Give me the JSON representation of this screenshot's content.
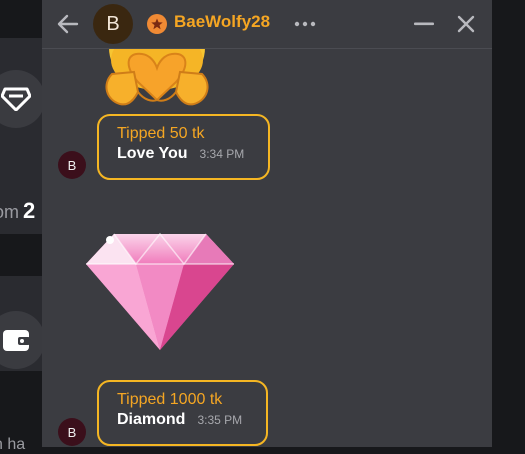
{
  "background_page": {
    "partial_text": "om",
    "partial_number": "2",
    "partial_bottom": "n ha"
  },
  "chat": {
    "username": "BaeWolfy28",
    "avatar_letter": "B",
    "messages": [
      {
        "avatar_letter": "B",
        "tip": "Tipped 50 tk",
        "text": "Love You",
        "time": "3:34 PM",
        "image": "heart-hands-emoji"
      },
      {
        "avatar_letter": "B",
        "tip": "Tipped 1000 tk",
        "text": "Diamond",
        "time": "3:35 PM",
        "image": "pink-diamond"
      }
    ]
  },
  "colors": {
    "accent": "#f5a623",
    "panel": "#3b3c41",
    "diamond": "#ec5aa6"
  }
}
